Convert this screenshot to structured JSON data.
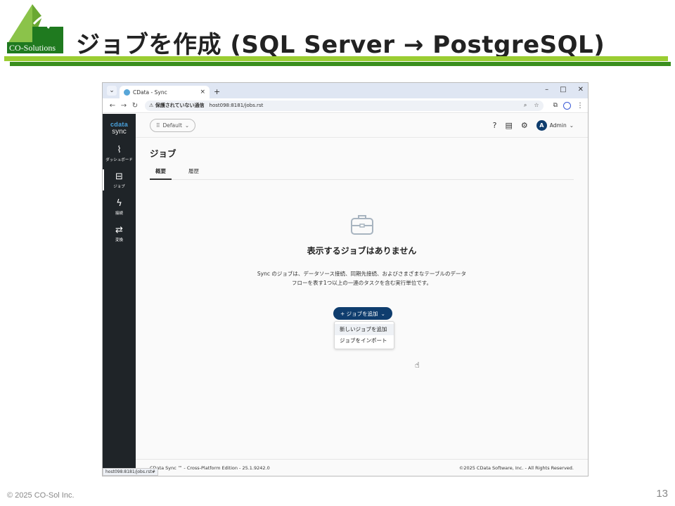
{
  "slide": {
    "logo_text": "CO-Solutions",
    "title": "ジョブを作成 (SQL Server → PostgreSQL)",
    "copyright": "© 2025 CO-Sol Inc.",
    "page_number": "13",
    "colors": {
      "accent_light": "#9acd32",
      "accent_dark": "#3a8f1e"
    }
  },
  "browser": {
    "tab_title": "CData - Sync",
    "tab_close": "×",
    "new_tab": "+",
    "window_controls": {
      "minimize": "–",
      "maximize": "□",
      "close": "✕"
    },
    "security_warning": "⚠ 保護されていない通信",
    "url": "host098:8181/jobs.rst",
    "status_url": "host098:8181/jobs.rst#"
  },
  "app": {
    "brand": {
      "top": "cdata",
      "bottom": "sync"
    },
    "sidebar": [
      {
        "label": "ダッシュボード",
        "icon": "chart-icon",
        "glyph": "⌇"
      },
      {
        "label": "ジョブ",
        "icon": "briefcase-icon",
        "glyph": "⊟"
      },
      {
        "label": "接続",
        "icon": "lightning-icon",
        "glyph": "ϟ"
      },
      {
        "label": "変換",
        "icon": "swap-icon",
        "glyph": "⇄"
      }
    ],
    "header": {
      "workspace": "Default",
      "user_initial": "A",
      "user_name": "Admin"
    },
    "page_title": "ジョブ",
    "tabs": [
      "概要",
      "履歴"
    ],
    "empty_state": {
      "title": "表示するジョブはありません",
      "description": "Sync のジョブは、データソース接続、同期先接続、およびさまざまなテーブルのデータフローを表す1つ以上の一連のタスクを含む実行単位です。"
    },
    "add_job_button": "+ ジョブを追加",
    "dropdown_items": [
      "新しいジョブを追加",
      "ジョブをインポート"
    ],
    "footer": {
      "left": "CData Sync ™ - Cross-Platform Edition - 25.1.9242.0",
      "right": "©2025 CData Software, Inc. - All Rights Reserved."
    },
    "colors": {
      "sidebar_bg": "#1f2428",
      "primary": "#0f3d6e",
      "brand_blue": "#4aa3df"
    }
  }
}
